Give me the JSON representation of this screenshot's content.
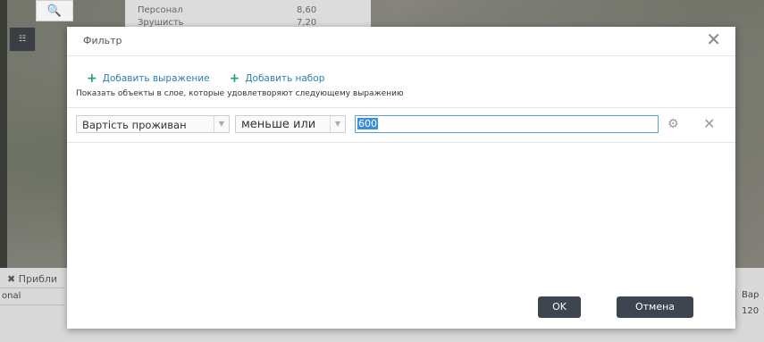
{
  "background": {
    "popup_rows": [
      {
        "label": "Персонал",
        "value": "8,60"
      },
      {
        "label": "Зрушисть",
        "value": "7,20"
      }
    ],
    "bottom_tab_label": "Прибли",
    "bottom_cell_left": "onal",
    "bottom_cell_right_header": "Вар",
    "bottom_cell_right_value": "120"
  },
  "dialog": {
    "title": "Фильтр",
    "add_expression_label": "Добавить выражение",
    "add_set_label": "Добавить набор",
    "hint": "Показать объекты в слое, которые удовлетворяют следующему выражению",
    "field_select": "Вартість проживан",
    "operator_select": "меньше или",
    "value": "600",
    "ok_label": "OK",
    "cancel_label": "Отмена"
  }
}
